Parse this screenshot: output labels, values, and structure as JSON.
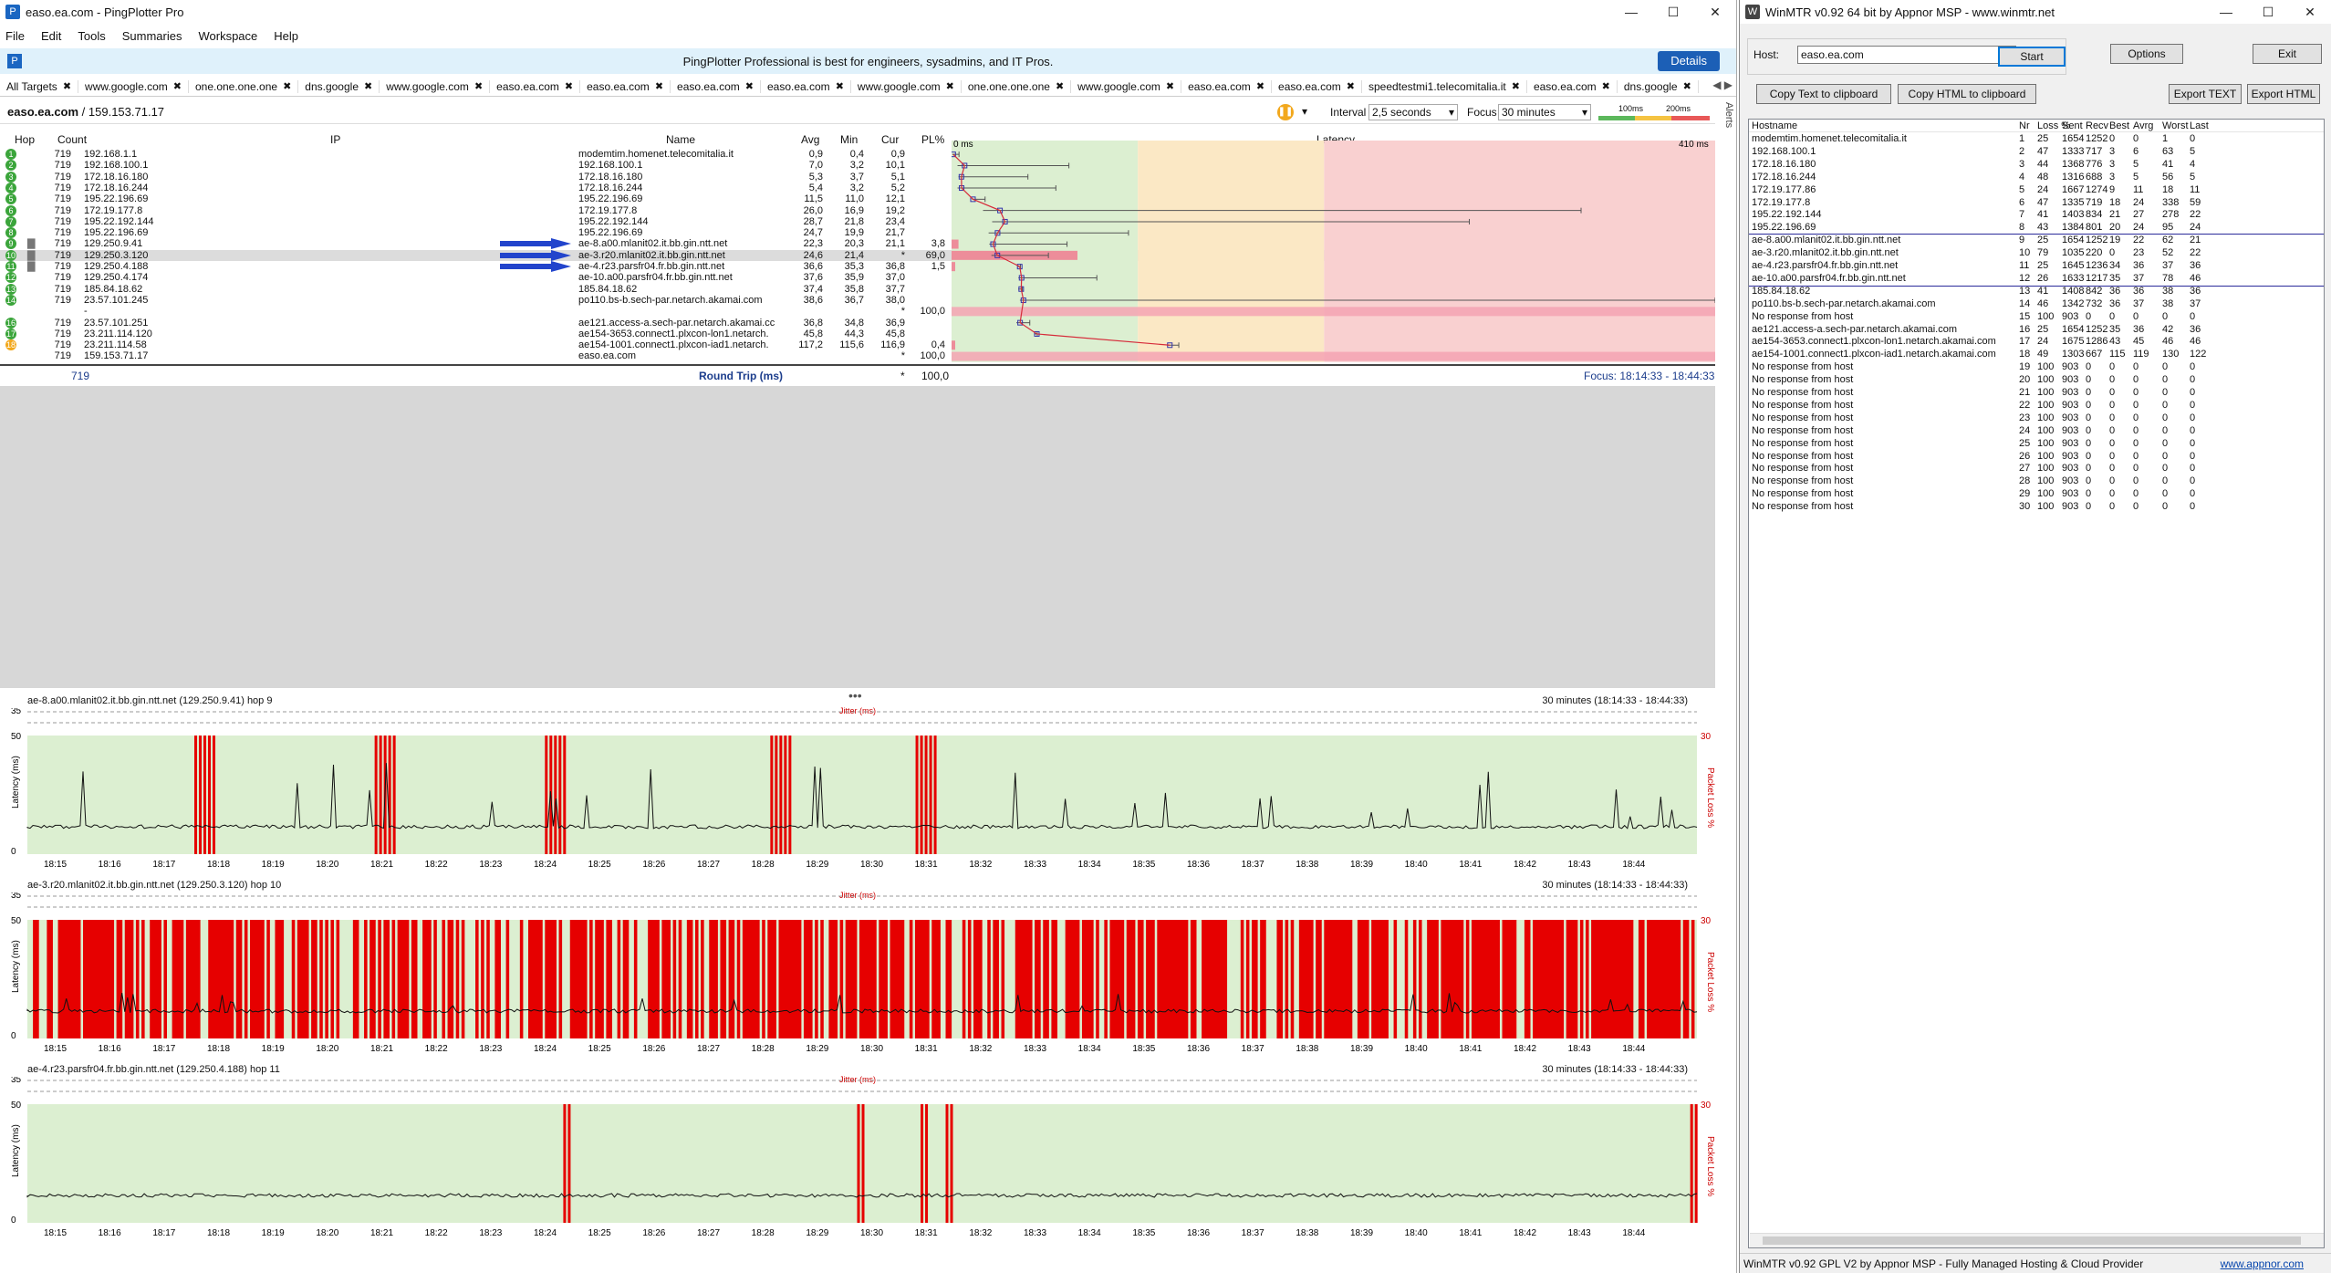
{
  "pingplotter": {
    "window_title": "easo.ea.com - PingPlotter Pro",
    "menu": [
      "File",
      "Edit",
      "Tools",
      "Summaries",
      "Workspace",
      "Help"
    ],
    "promo": {
      "text": "PingPlotter Professional is best for engineers, sysadmins, and IT Pros.",
      "button": "Details"
    },
    "tabs": [
      "All Targets",
      "www.google.com",
      "one.one.one.one",
      "dns.google",
      "www.google.com",
      "easo.ea.com",
      "easo.ea.com",
      "easo.ea.com",
      "easo.ea.com",
      "www.google.com",
      "one.one.one.one",
      "www.google.com",
      "easo.ea.com",
      "easo.ea.com",
      "speedtestmi1.telecomitalia.it",
      "easo.ea.com",
      "dns.google"
    ],
    "target": {
      "name": "easo.ea.com",
      "sep": " / ",
      "ip": "159.153.71.17"
    },
    "interval": {
      "label": "Interval",
      "value": "2,5 seconds"
    },
    "focus": {
      "label": "Focus",
      "value": "30 minutes"
    },
    "scale": {
      "a": "100ms",
      "b": "200ms"
    },
    "alerts_label": "Alerts",
    "columns": {
      "hop": "Hop",
      "count": "Count",
      "ip": "IP",
      "name": "Name",
      "avg": "Avg",
      "min": "Min",
      "cur": "Cur",
      "pl": "PL%",
      "latency": "Latency"
    },
    "latency_axis": {
      "left": "0 ms",
      "right": "410 ms",
      "max": 410,
      "zone_good": 100,
      "zone_warn": 200
    },
    "hops": [
      {
        "hop": "1",
        "count": "719",
        "ip": "192.168.1.1",
        "name": "modemtim.homenet.telecomitalia.it",
        "avg": "0,9",
        "min": "0,4",
        "cur": "0,9",
        "pl": "",
        "color": "#3ba53b",
        "avg_ms": 0.9,
        "min_ms": 0.4,
        "max_ms": 4,
        "pl_val": 0
      },
      {
        "hop": "2",
        "count": "719",
        "ip": "192.168.100.1",
        "name": "192.168.100.1",
        "avg": "7,0",
        "min": "3,2",
        "cur": "10,1",
        "pl": "",
        "color": "#3ba53b",
        "avg_ms": 7.0,
        "min_ms": 3.2,
        "max_ms": 63,
        "pl_val": 0
      },
      {
        "hop": "3",
        "count": "719",
        "ip": "172.18.16.180",
        "name": "172.18.16.180",
        "avg": "5,3",
        "min": "3,7",
        "cur": "5,1",
        "pl": "",
        "color": "#3ba53b",
        "avg_ms": 5.3,
        "min_ms": 3.7,
        "max_ms": 41,
        "pl_val": 0
      },
      {
        "hop": "4",
        "count": "719",
        "ip": "172.18.16.244",
        "name": "172.18.16.244",
        "avg": "5,4",
        "min": "3,2",
        "cur": "5,2",
        "pl": "",
        "color": "#3ba53b",
        "avg_ms": 5.4,
        "min_ms": 3.2,
        "max_ms": 56,
        "pl_val": 0
      },
      {
        "hop": "5",
        "count": "719",
        "ip": "195.22.196.69",
        "name": "195.22.196.69",
        "avg": "11,5",
        "min": "11,0",
        "cur": "12,1",
        "pl": "",
        "color": "#3ba53b",
        "avg_ms": 11.5,
        "min_ms": 11.0,
        "max_ms": 18,
        "pl_val": 0
      },
      {
        "hop": "6",
        "count": "719",
        "ip": "172.19.177.8",
        "name": "172.19.177.8",
        "avg": "26,0",
        "min": "16,9",
        "cur": "19,2",
        "pl": "",
        "color": "#3ba53b",
        "avg_ms": 26.0,
        "min_ms": 16.9,
        "max_ms": 338,
        "pl_val": 0
      },
      {
        "hop": "7",
        "count": "719",
        "ip": "195.22.192.144",
        "name": "195.22.192.144",
        "avg": "28,7",
        "min": "21,8",
        "cur": "23,4",
        "pl": "",
        "color": "#3ba53b",
        "avg_ms": 28.7,
        "min_ms": 21.8,
        "max_ms": 278,
        "pl_val": 0
      },
      {
        "hop": "8",
        "count": "719",
        "ip": "195.22.196.69",
        "name": "195.22.196.69",
        "avg": "24,7",
        "min": "19,9",
        "cur": "21,7",
        "pl": "",
        "color": "#3ba53b",
        "avg_ms": 24.7,
        "min_ms": 19.9,
        "max_ms": 95,
        "pl_val": 0
      },
      {
        "hop": "9",
        "count": "719",
        "ip": "129.250.9.41",
        "name": "ae-8.a00.mlanit02.it.bb.gin.ntt.net",
        "avg": "22,3",
        "min": "20,3",
        "cur": "21,1",
        "pl": "3,8",
        "color": "#3ba53b",
        "avg_ms": 22.3,
        "min_ms": 20.3,
        "max_ms": 62,
        "pl_val": 3.8,
        "bars": true,
        "arrow": true
      },
      {
        "hop": "10",
        "count": "719",
        "ip": "129.250.3.120",
        "name": "ae-3.r20.mlanit02.it.bb.gin.ntt.net",
        "avg": "24,6",
        "min": "21,4",
        "cur": "*",
        "pl": "69,0",
        "color": "#3ba53b",
        "avg_ms": 24.6,
        "min_ms": 21.4,
        "max_ms": 52,
        "pl_val": 69.0,
        "bars": true,
        "arrow": true,
        "selected": true
      },
      {
        "hop": "11",
        "count": "719",
        "ip": "129.250.4.188",
        "name": "ae-4.r23.parsfr04.fr.bb.gin.ntt.net",
        "avg": "36,6",
        "min": "35,3",
        "cur": "36,8",
        "pl": "1,5",
        "color": "#3ba53b",
        "avg_ms": 36.6,
        "min_ms": 35.3,
        "max_ms": 37,
        "pl_val": 1.5,
        "bars": true,
        "arrow": true
      },
      {
        "hop": "12",
        "count": "719",
        "ip": "129.250.4.174",
        "name": "ae-10.a00.parsfr04.fr.bb.gin.ntt.net",
        "avg": "37,6",
        "min": "35,9",
        "cur": "37,0",
        "pl": "",
        "color": "#3ba53b",
        "avg_ms": 37.6,
        "min_ms": 35.9,
        "max_ms": 78,
        "pl_val": 0
      },
      {
        "hop": "13",
        "count": "719",
        "ip": "185.84.18.62",
        "name": "185.84.18.62",
        "avg": "37,4",
        "min": "35,8",
        "cur": "37,7",
        "pl": "",
        "color": "#3ba53b",
        "avg_ms": 37.4,
        "min_ms": 35.8,
        "max_ms": 38,
        "pl_val": 0
      },
      {
        "hop": "14",
        "count": "719",
        "ip": "23.57.101.245",
        "name": "po110.bs-b.sech-par.netarch.akamai.com",
        "avg": "38,6",
        "min": "36,7",
        "cur": "38,0",
        "pl": "",
        "color": "#3ba53b",
        "avg_ms": 38.6,
        "min_ms": 36.7,
        "max_ms": 410,
        "pl_val": 0
      },
      {
        "hop": "",
        "count": "",
        "ip": "-",
        "name": "",
        "avg": "",
        "min": "",
        "cur": "*",
        "pl": "100,0",
        "color": "",
        "pl_val": 100
      },
      {
        "hop": "16",
        "count": "719",
        "ip": "23.57.101.251",
        "name": "ae121.access-a.sech-par.netarch.akamai.cc",
        "avg": "36,8",
        "min": "34,8",
        "cur": "36,9",
        "pl": "",
        "color": "#3ba53b",
        "avg_ms": 36.8,
        "min_ms": 34.8,
        "max_ms": 42,
        "pl_val": 0
      },
      {
        "hop": "17",
        "count": "719",
        "ip": "23.211.114.120",
        "name": "ae154-3653.connect1.plxcon-lon1.netarch.",
        "avg": "45,8",
        "min": "44,3",
        "cur": "45,8",
        "pl": "",
        "color": "#3ba53b",
        "avg_ms": 45.8,
        "min_ms": 44.3,
        "max_ms": 46,
        "pl_val": 0
      },
      {
        "hop": "18",
        "count": "719",
        "ip": "23.211.114.58",
        "name": "ae154-1001.connect1.plxcon-iad1.netarch.",
        "avg": "117,2",
        "min": "115,6",
        "cur": "116,9",
        "pl": "0,4",
        "color": "#f2a81d",
        "avg_ms": 117.2,
        "min_ms": 115.6,
        "max_ms": 122,
        "pl_val": 0.4
      },
      {
        "hop": "",
        "count": "719",
        "ip": "159.153.71.17",
        "name": "easo.ea.com",
        "avg": "",
        "min": "",
        "cur": "*",
        "pl": "100,0",
        "color": "",
        "pl_val": 100
      }
    ],
    "round_trip": {
      "count": "719",
      "label": "Round Trip (ms)",
      "cur": "*",
      "pl": "100,0",
      "focus": "Focus: 18:14:33 - 18:44:33"
    },
    "graphs": [
      {
        "title": "ae-8.a00.mlanit02.it.bb.gin.ntt.net (129.250.9.41) hop 9",
        "range": "30 minutes (18:14:33 - 18:44:33)",
        "jitter": "Jitter (ms)",
        "y_left": "Latency (ms)",
        "y_right": "Packet Loss %",
        "y_ticks": [
          "35",
          "50",
          "0"
        ],
        "pl_tick": "30",
        "density": "sparse"
      },
      {
        "title": "ae-3.r20.mlanit02.it.bb.gin.ntt.net (129.250.3.120) hop 10",
        "range": "30 minutes (18:14:33 - 18:44:33)",
        "jitter": "Jitter (ms)",
        "y_left": "Latency (ms)",
        "y_right": "Packet Loss %",
        "y_ticks": [
          "35",
          "50",
          "0"
        ],
        "pl_tick": "30",
        "density": "dense"
      },
      {
        "title": "ae-4.r23.parsfr04.fr.bb.gin.ntt.net (129.250.4.188) hop 11",
        "range": "30 minutes (18:14:33 - 18:44:33)",
        "jitter": "Jitter (ms)",
        "y_left": "Latency (ms)",
        "y_right": "Packet Loss %",
        "y_ticks": [
          "35",
          "50",
          "0"
        ],
        "pl_tick": "30",
        "density": "rare"
      }
    ],
    "time_ticks": [
      "18:15",
      "18:16",
      "18:17",
      "18:18",
      "18:19",
      "18:20",
      "18:21",
      "18:22",
      "18:23",
      "18:24",
      "18:25",
      "18:26",
      "18:27",
      "18:28",
      "18:29",
      "18:30",
      "18:31",
      "18:32",
      "18:33",
      "18:34",
      "18:35",
      "18:36",
      "18:37",
      "18:38",
      "18:39",
      "18:40",
      "18:41",
      "18:42",
      "18:43",
      "18:44"
    ]
  },
  "winmtr": {
    "window_title": "WinMTR v0.92 64 bit by Appnor MSP - www.winmtr.net",
    "host_label": "Host:",
    "host_value": "easo.ea.com",
    "buttons": {
      "start": "Start",
      "options": "Options",
      "exit": "Exit",
      "copy_text": "Copy Text to clipboard",
      "copy_html": "Copy HTML to clipboard",
      "export_text": "Export TEXT",
      "export_html": "Export HTML"
    },
    "columns": [
      "Hostname",
      "Nr",
      "Loss %",
      "Sent",
      "Recv",
      "Best",
      "Avrg",
      "Worst",
      "Last"
    ],
    "rows": [
      [
        "modemtim.homenet.telecomitalia.it",
        "1",
        "25",
        "1654",
        "1252",
        "0",
        "0",
        "1",
        "0"
      ],
      [
        "192.168.100.1",
        "2",
        "47",
        "1333",
        "717",
        "3",
        "6",
        "63",
        "5"
      ],
      [
        "172.18.16.180",
        "3",
        "44",
        "1368",
        "776",
        "3",
        "5",
        "41",
        "4"
      ],
      [
        "172.18.16.244",
        "4",
        "48",
        "1316",
        "688",
        "3",
        "5",
        "56",
        "5"
      ],
      [
        "172.19.177.86",
        "5",
        "24",
        "1667",
        "1274",
        "9",
        "11",
        "18",
        "11"
      ],
      [
        "172.19.177.8",
        "6",
        "47",
        "1335",
        "719",
        "18",
        "24",
        "338",
        "59"
      ],
      [
        "195.22.192.144",
        "7",
        "41",
        "1403",
        "834",
        "21",
        "27",
        "278",
        "22"
      ],
      [
        "195.22.196.69",
        "8",
        "43",
        "1384",
        "801",
        "20",
        "24",
        "95",
        "24"
      ],
      [
        "ae-8.a00.mlanit02.it.bb.gin.ntt.net",
        "9",
        "25",
        "1654",
        "1252",
        "19",
        "22",
        "62",
        "21"
      ],
      [
        "ae-3.r20.mlanit02.it.bb.gin.ntt.net",
        "10",
        "79",
        "1035",
        "220",
        "0",
        "23",
        "52",
        "22"
      ],
      [
        "ae-4.r23.parsfr04.fr.bb.gin.ntt.net",
        "11",
        "25",
        "1645",
        "1236",
        "34",
        "36",
        "37",
        "36"
      ],
      [
        "ae-10.a00.parsfr04.fr.bb.gin.ntt.net",
        "12",
        "26",
        "1633",
        "1217",
        "35",
        "37",
        "78",
        "46"
      ],
      [
        "185.84.18.62",
        "13",
        "41",
        "1408",
        "842",
        "36",
        "36",
        "38",
        "36"
      ],
      [
        "po110.bs-b.sech-par.netarch.akamai.com",
        "14",
        "46",
        "1342",
        "732",
        "36",
        "37",
        "38",
        "37"
      ],
      [
        "No response from host",
        "15",
        "100",
        "903",
        "0",
        "0",
        "0",
        "0",
        "0"
      ],
      [
        "ae121.access-a.sech-par.netarch.akamai.com",
        "16",
        "25",
        "1654",
        "1252",
        "35",
        "36",
        "42",
        "36"
      ],
      [
        "ae154-3653.connect1.plxcon-lon1.netarch.akamai.com",
        "17",
        "24",
        "1675",
        "1286",
        "43",
        "45",
        "46",
        "46"
      ],
      [
        "ae154-1001.connect1.plxcon-iad1.netarch.akamai.com",
        "18",
        "49",
        "1303",
        "667",
        "115",
        "119",
        "130",
        "122"
      ],
      [
        "No response from host",
        "19",
        "100",
        "903",
        "0",
        "0",
        "0",
        "0",
        "0"
      ],
      [
        "No response from host",
        "20",
        "100",
        "903",
        "0",
        "0",
        "0",
        "0",
        "0"
      ],
      [
        "No response from host",
        "21",
        "100",
        "903",
        "0",
        "0",
        "0",
        "0",
        "0"
      ],
      [
        "No response from host",
        "22",
        "100",
        "903",
        "0",
        "0",
        "0",
        "0",
        "0"
      ],
      [
        "No response from host",
        "23",
        "100",
        "903",
        "0",
        "0",
        "0",
        "0",
        "0"
      ],
      [
        "No response from host",
        "24",
        "100",
        "903",
        "0",
        "0",
        "0",
        "0",
        "0"
      ],
      [
        "No response from host",
        "25",
        "100",
        "903",
        "0",
        "0",
        "0",
        "0",
        "0"
      ],
      [
        "No response from host",
        "26",
        "100",
        "903",
        "0",
        "0",
        "0",
        "0",
        "0"
      ],
      [
        "No response from host",
        "27",
        "100",
        "903",
        "0",
        "0",
        "0",
        "0",
        "0"
      ],
      [
        "No response from host",
        "28",
        "100",
        "903",
        "0",
        "0",
        "0",
        "0",
        "0"
      ],
      [
        "No response from host",
        "29",
        "100",
        "903",
        "0",
        "0",
        "0",
        "0",
        "0"
      ],
      [
        "No response from host",
        "30",
        "100",
        "903",
        "0",
        "0",
        "0",
        "0",
        "0"
      ]
    ],
    "status_left": "WinMTR v0.92 GPL V2 by Appnor MSP - Fully Managed Hosting & Cloud Provider",
    "status_right": "www.appnor.com"
  }
}
